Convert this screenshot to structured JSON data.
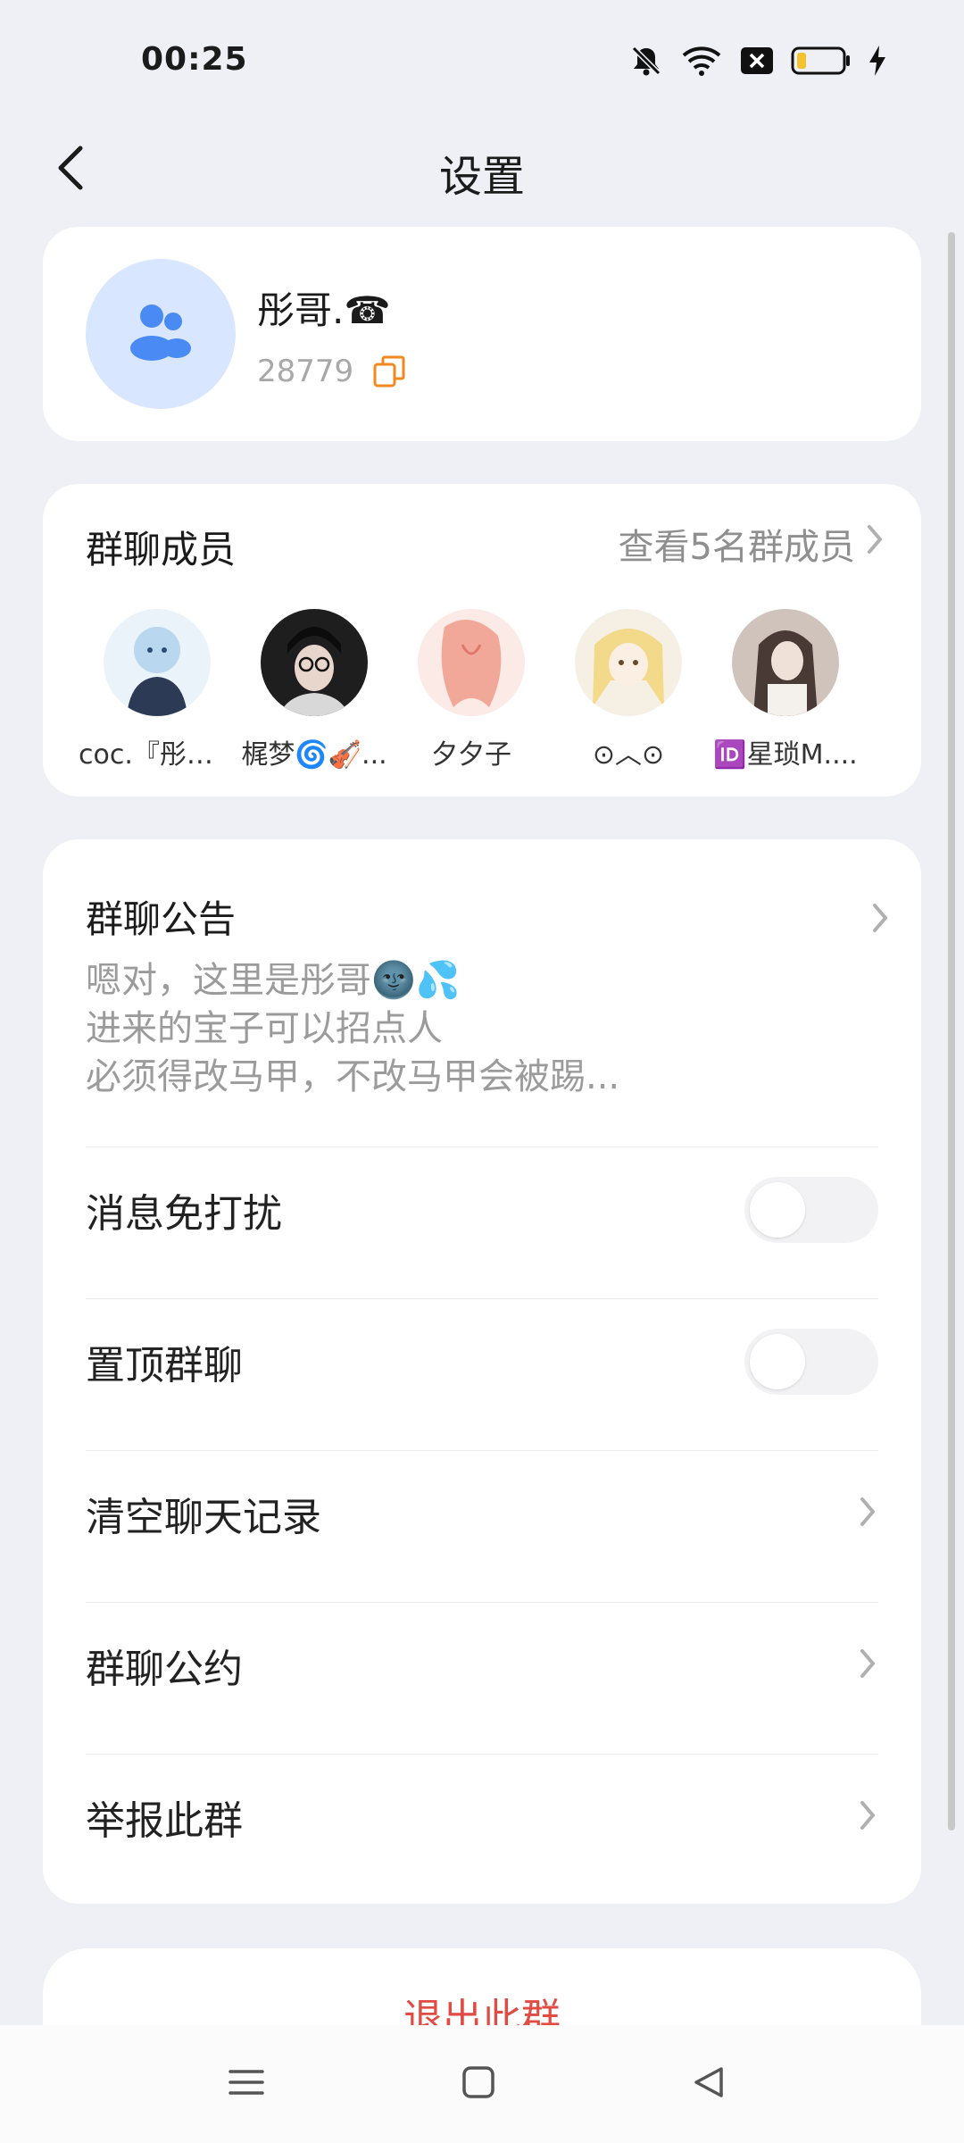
{
  "status_bar": {
    "time": "00:25",
    "icons": [
      "mute-bell-icon",
      "wifi-icon",
      "sim-x-icon",
      "battery-icon",
      "charging-icon"
    ]
  },
  "header": {
    "title": "设置",
    "back_icon": "back-chevron-icon"
  },
  "group": {
    "name": "彤哥.☎",
    "id": "28779",
    "avatar_icon": "group-people-icon",
    "copy_icon": "copy-icon",
    "colors": {
      "avatar_bg": "#d9e6ff",
      "avatar_fg": "#4a8af4",
      "copy": "#f08a1d"
    }
  },
  "members": {
    "title": "群聊成员",
    "view_all": "查看5名群成员",
    "list": [
      {
        "name": "coc.『彤哥....",
        "avatar_color": "#b9d7ee"
      },
      {
        "name": "梶梦🌀🎻...",
        "avatar_color": "#2a2a2a"
      },
      {
        "name": "夕夕子",
        "avatar_color": "#f2b3a6"
      },
      {
        "name": "⊙︿⊙",
        "avatar_color": "#f3e2a6"
      },
      {
        "name": "🆔星琐M....",
        "avatar_color": "#c9b8ae"
      }
    ]
  },
  "settings": {
    "notice": {
      "title": "群聊公告",
      "lines": [
        "嗯对，这里是彤哥🌚💦",
        "进来的宝子可以招点人",
        "必须得改马甲，不改马甲会被踢..."
      ]
    },
    "rows": [
      {
        "label": "消息免打扰",
        "type": "toggle",
        "on": false
      },
      {
        "label": "置顶群聊",
        "type": "toggle",
        "on": false
      },
      {
        "label": "清空聊天记录",
        "type": "link"
      },
      {
        "label": "群聊公约",
        "type": "link"
      },
      {
        "label": "举报此群",
        "type": "link"
      }
    ]
  },
  "exit": {
    "label": "退出此群",
    "color": "#e04b43"
  },
  "nav_bar": {
    "buttons": [
      "menu-icon",
      "home-square-icon",
      "back-triangle-icon"
    ]
  }
}
